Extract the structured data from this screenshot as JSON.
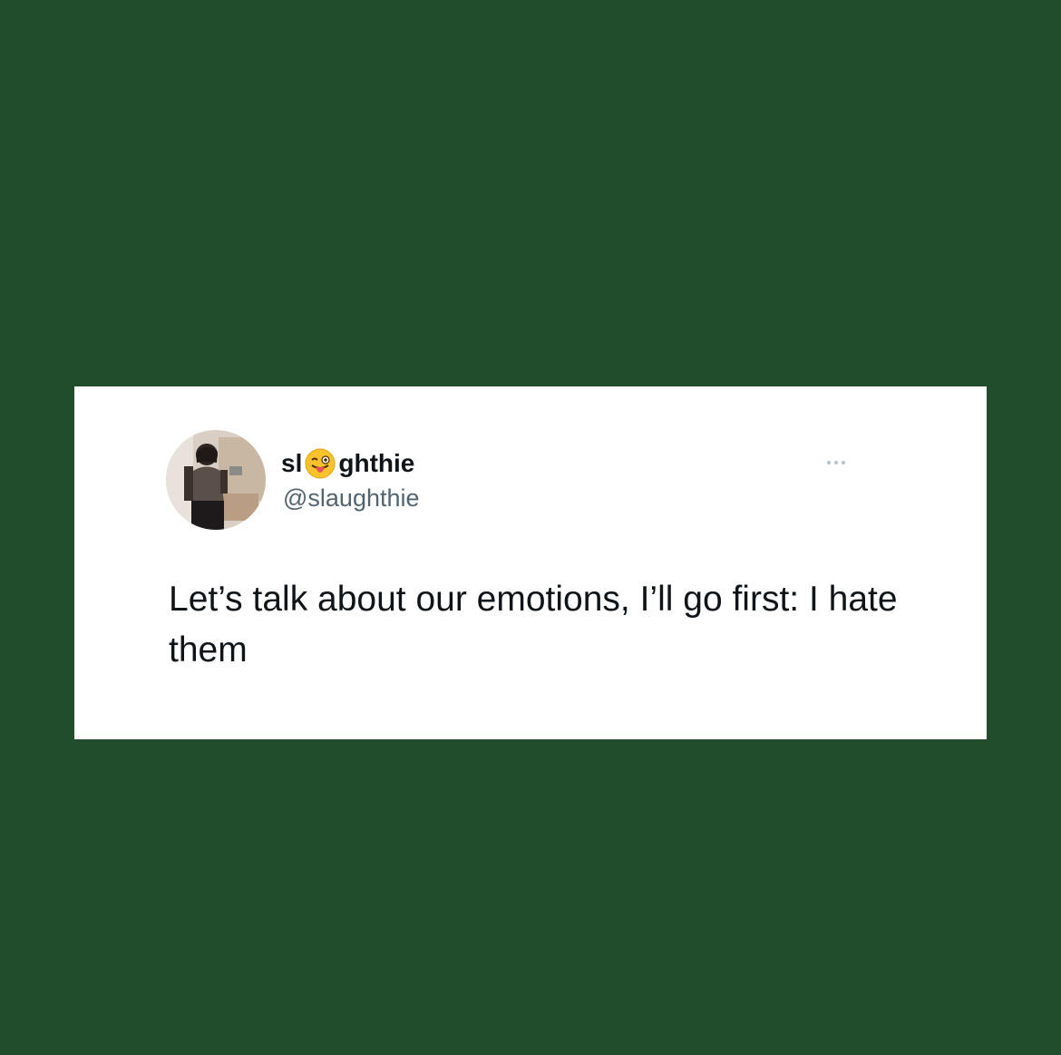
{
  "colors": {
    "background": "#214d2d",
    "card": "#ffffff",
    "text_primary": "#0f1419",
    "text_secondary": "#536471"
  },
  "tweet": {
    "author": {
      "name_prefix": "sl",
      "name_emoji": "winking-face-with-tongue-icon",
      "name_suffix": "ghthie",
      "handle": "@slaughthie",
      "avatar": "profile-photo"
    },
    "more_icon": "more-options-icon",
    "text": "Let’s talk about our emotions, I’ll go first: I hate them"
  }
}
